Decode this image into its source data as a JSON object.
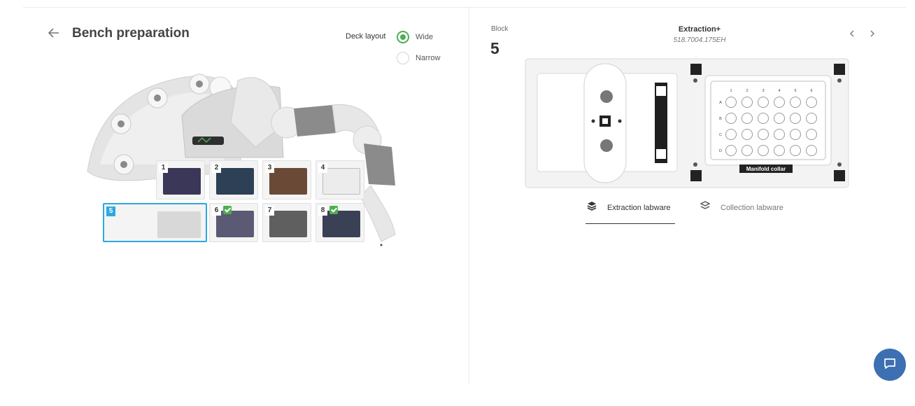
{
  "header": {
    "title": "Bench preparation",
    "deck_layout_label": "Deck layout",
    "layout_options": [
      {
        "label": "Wide",
        "selected": true
      },
      {
        "label": "Narrow",
        "selected": false
      }
    ]
  },
  "deck": {
    "slots": [
      {
        "number": "1",
        "color": "#3a3758",
        "checked": false,
        "selected": false
      },
      {
        "number": "2",
        "color": "#2d4056",
        "checked": false,
        "selected": false
      },
      {
        "number": "3",
        "color": "#6a4a36",
        "checked": false,
        "selected": false
      },
      {
        "number": "4",
        "color": "#ececec",
        "checked": false,
        "selected": false
      },
      {
        "number": "5",
        "color": "#d8d8d8",
        "checked": false,
        "selected": true
      },
      {
        "number": "6",
        "color": "#5a5a74",
        "checked": true,
        "selected": false
      },
      {
        "number": "7",
        "color": "#5f5f5f",
        "checked": false,
        "selected": false
      },
      {
        "number": "8",
        "color": "#3b4154",
        "checked": true,
        "selected": false
      }
    ]
  },
  "block": {
    "label": "Block",
    "number": "5",
    "name": "Extraction+",
    "code": "518.7004.175EH",
    "manifold_label": "Manifold collar",
    "column_labels": [
      "1",
      "2",
      "3",
      "4",
      "5",
      "6"
    ],
    "row_labels": [
      "A",
      "B",
      "C",
      "D"
    ]
  },
  "tabs": [
    {
      "label": "Extraction labware",
      "active": true
    },
    {
      "label": "Collection labware",
      "active": false
    }
  ],
  "icons": {
    "back": "arrow-left-icon",
    "prev": "chevron-left-icon",
    "next": "chevron-right-icon",
    "tab": "layers-icon",
    "chat": "chat-icon"
  },
  "colors": {
    "accent_green": "#4caf50",
    "selection_blue": "#2fa7e0",
    "chat_button": "#3d6fb3"
  }
}
